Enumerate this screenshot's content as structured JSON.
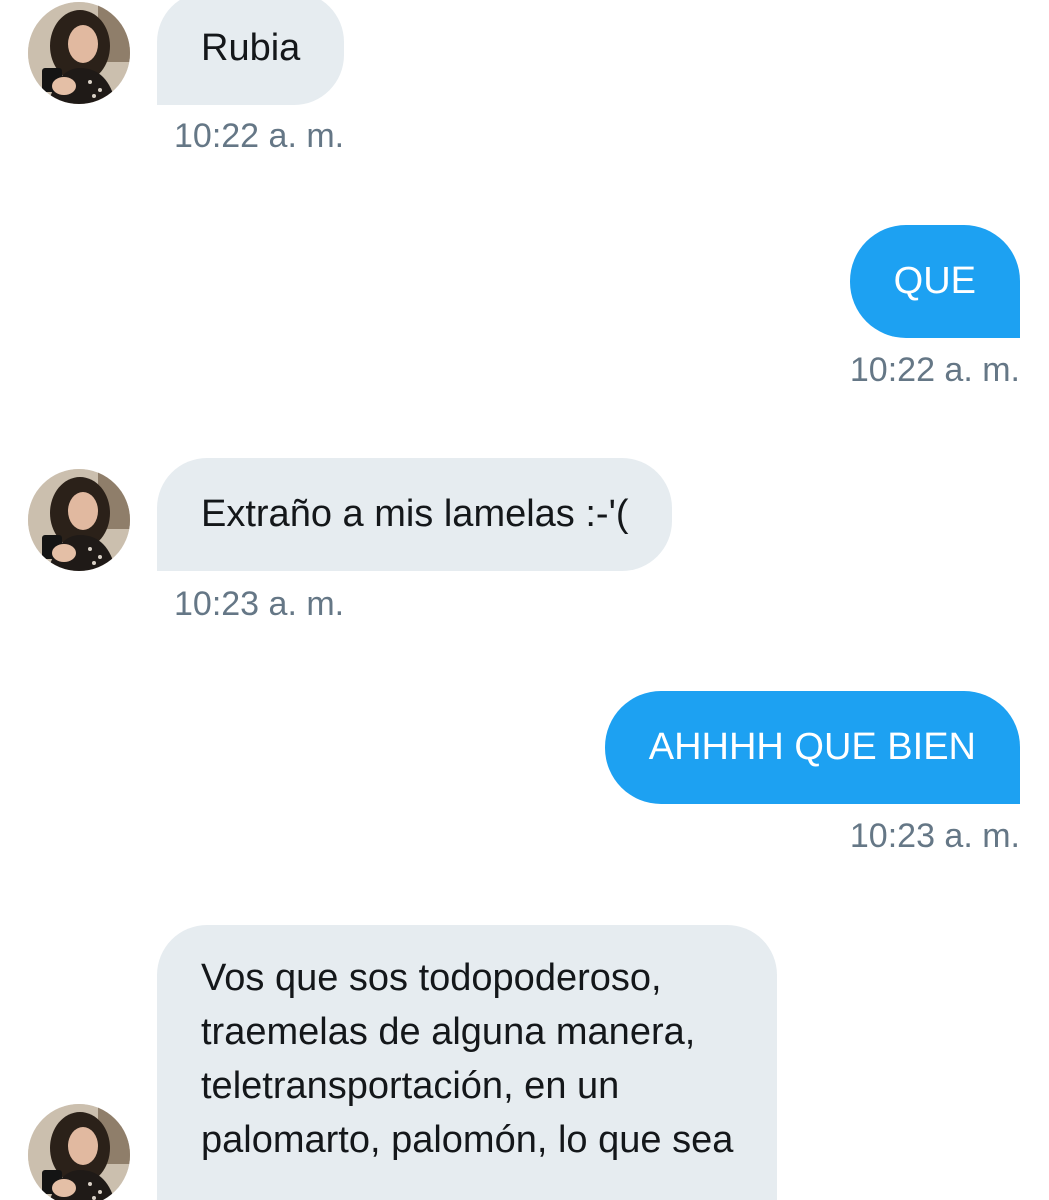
{
  "messages": [
    {
      "direction": "in",
      "text": "Rubia",
      "time": "10:22 a. m."
    },
    {
      "direction": "out",
      "text": "QUE",
      "time": "10:22 a. m."
    },
    {
      "direction": "in",
      "text": "Extraño a mis lamelas :-'(",
      "time": "10:23 a. m."
    },
    {
      "direction": "out",
      "text": "AHHHH QUE BIEN",
      "time": "10:23 a. m."
    },
    {
      "direction": "in",
      "lines": [
        "Vos que sos todopoderoso,",
        "traemelas de alguna manera,",
        "teletransportación, en un",
        "palomarto, palomón, lo que sea"
      ]
    }
  ],
  "colors": {
    "incoming_bubble": "#e6ecf0",
    "outgoing_bubble": "#1da1f2",
    "timestamp": "#657786"
  },
  "icons": {
    "avatar": "profile-photo-avatar"
  }
}
